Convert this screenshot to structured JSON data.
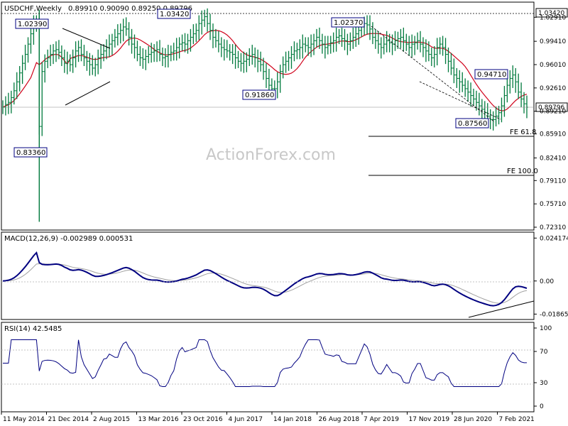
{
  "chart_data": [
    {
      "type": "candlestick",
      "title": "USDCHF,Weekly",
      "ohlc_readout": "0.89910 0.90090 0.89250 0.89796",
      "current_price": "0.89796",
      "y_ticks": [
        "1.02910",
        "0.99410",
        "0.96010",
        "0.92610",
        "0.89210",
        "0.85910",
        "0.82410",
        "0.79110",
        "0.75710",
        "0.72310"
      ],
      "ylim": [
        0.7231,
        1.046
      ],
      "x_labels": [
        "11 May 2014",
        "21 Dec 2014",
        "2 Aug 2015",
        "13 Mar 2016",
        "23 Oct 2016",
        "4 Jun 2017",
        "14 Jan 2018",
        "26 Aug 2018",
        "7 Apr 2019",
        "17 Nov 2019",
        "28 Jun 2020",
        "7 Feb 2021"
      ],
      "price_labels": [
        {
          "text": "1.02390",
          "value": 1.0239
        },
        {
          "text": "0.83360",
          "value": 0.8336
        },
        {
          "text": "1.03420",
          "value": 1.0342
        },
        {
          "text": "0.91860",
          "value": 0.9186
        },
        {
          "text": "1.02370",
          "value": 1.0237
        },
        {
          "text": "0.94710",
          "value": 0.9471
        },
        {
          "text": "0.87560",
          "value": 0.8756
        }
      ],
      "hline_label": "1.03420",
      "fe_levels": [
        {
          "label": "FE 61.8",
          "value": 0.8631
        },
        {
          "label": "FE 100.0",
          "value": 0.806
        }
      ],
      "close_series": [
        0.898,
        0.902,
        0.905,
        0.912,
        0.922,
        0.935,
        0.948,
        0.962,
        0.975,
        0.99,
        1.005,
        1.018,
        1.022,
        0.87,
        0.95,
        0.965,
        0.97,
        0.975,
        0.98,
        0.982,
        0.978,
        0.97,
        0.962,
        0.965,
        0.96,
        0.97,
        0.98,
        0.985,
        0.975,
        0.97,
        0.965,
        0.96,
        0.955,
        0.96,
        0.97,
        0.975,
        0.98,
        0.985,
        0.99,
        0.995,
        1.0,
        1.005,
        1.01,
        1.015,
        1.012,
        1.0,
        0.99,
        0.985,
        0.975,
        0.97,
        0.968,
        0.972,
        0.975,
        0.978,
        0.98,
        0.982,
        0.975,
        0.97,
        0.972,
        0.975,
        0.978,
        0.98,
        0.985,
        0.99,
        0.992,
        0.99,
        0.995,
        1.0,
        1.005,
        1.01,
        1.02,
        1.025,
        1.03,
        1.02,
        1.01,
        1.0,
        0.995,
        0.99,
        0.985,
        0.982,
        0.98,
        0.978,
        0.975,
        0.97,
        0.965,
        0.962,
        0.965,
        0.968,
        0.972,
        0.975,
        0.97,
        0.965,
        0.96,
        0.95,
        0.94,
        0.93,
        0.925,
        0.925,
        0.935,
        0.95,
        0.96,
        0.965,
        0.97,
        0.975,
        0.98,
        0.982,
        0.985,
        0.99,
        0.988,
        0.985,
        0.99,
        0.995,
        1.0,
        0.995,
        0.99,
        0.985,
        0.988,
        0.992,
        0.995,
        1.0,
        1.002,
        0.998,
        0.995,
        0.99,
        0.995,
        1.0,
        1.005,
        1.01,
        1.015,
        1.02,
        1.018,
        1.012,
        1.0,
        0.995,
        0.99,
        0.985,
        0.99,
        0.995,
        0.992,
        0.99,
        0.995,
        0.998,
        1.0,
        0.995,
        0.99,
        0.985,
        0.99,
        0.992,
        0.995,
        0.99,
        0.985,
        0.98,
        0.975,
        0.97,
        0.975,
        0.985,
        0.99,
        0.985,
        0.975,
        0.965,
        0.955,
        0.945,
        0.94,
        0.935,
        0.93,
        0.925,
        0.92,
        0.915,
        0.91,
        0.905,
        0.9,
        0.895,
        0.89,
        0.885,
        0.88,
        0.88,
        0.885,
        0.89,
        0.9,
        0.915,
        0.93,
        0.94,
        0.945,
        0.935,
        0.92,
        0.91,
        0.903,
        0.898
      ]
    },
    {
      "type": "line",
      "title": "MACD(12,26,9) -0.002989 0.000531",
      "y_ticks": [
        "0.024174",
        "0.00",
        "-0.018653"
      ],
      "ylim": [
        -0.0205,
        0.0255
      ]
    },
    {
      "type": "line",
      "title": "RSI(14) 42.5485",
      "y_ticks": [
        "100",
        "70",
        "30",
        "0"
      ],
      "ylim": [
        0,
        100
      ],
      "levels": [
        70,
        30
      ]
    }
  ],
  "watermark": "ActionForex.com",
  "colors": {
    "price_bar": "#007a3d",
    "ma": "#d0021b",
    "macd": "#000080",
    "signal": "#a0a0a0",
    "box_border": "#000080",
    "fe_line": "#000000"
  }
}
